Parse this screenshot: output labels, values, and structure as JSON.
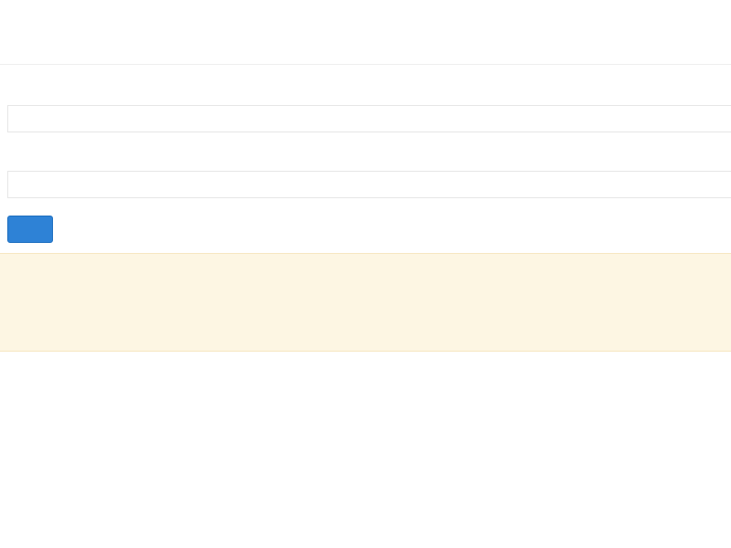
{
  "form": {
    "url_label": "",
    "url_value": "",
    "encoding_label": "",
    "encoding_value": "",
    "submit_label": ""
  },
  "notice": {
    "line1": "",
    "line2_prefix": "",
    "line2_link1": "",
    "line2_middle": "",
    "line2_link2": "",
    "line2_suffix": "",
    "line3_prefix": "",
    "line3_link": "",
    "line3_suffix": ""
  },
  "result": {
    "rows": [
      {
        "label": "",
        "value": ""
      },
      {
        "label": "",
        "value": ""
      },
      {
        "label": "",
        "value": ""
      },
      {
        "label": "",
        "value": ""
      }
    ],
    "status_text": "",
    "table_headers": [
      "",
      ""
    ]
  },
  "colors": {
    "accent": "#2e82d6",
    "notice_bg": "#fdf6e3",
    "link": "#1a5fb4",
    "status_red": "#e02020"
  }
}
